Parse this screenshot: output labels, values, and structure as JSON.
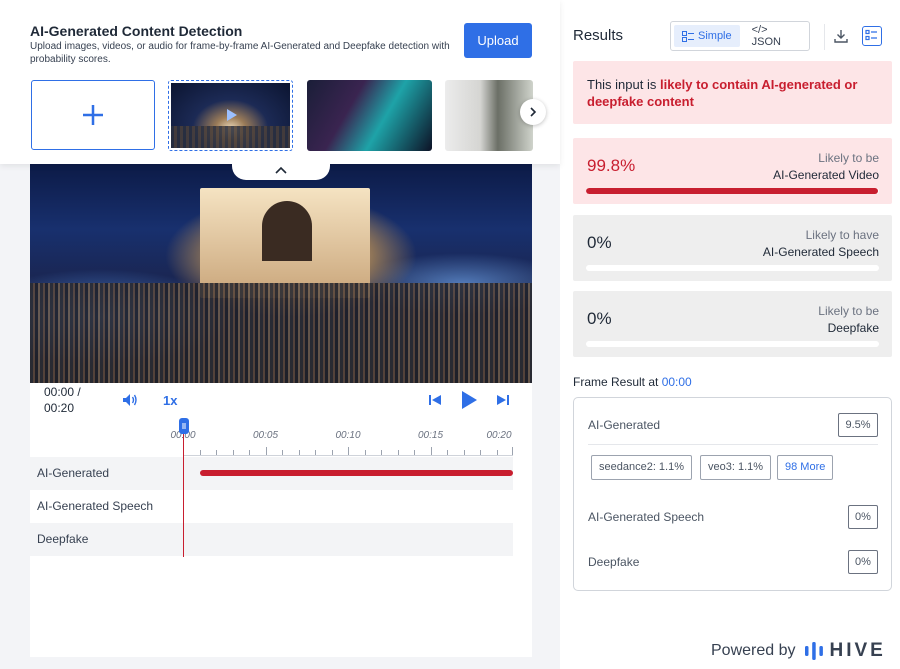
{
  "header": {
    "title": "AI-Generated Content Detection",
    "description": "Upload images, videos, or audio for frame-by-frame AI-Generated and Deepfake detection with probability scores.",
    "upload_label": "Upload"
  },
  "player": {
    "time": "00:00 /\n00:20",
    "speed": "1x"
  },
  "timeline": {
    "ticks": [
      "00:00",
      "00:05",
      "00:10",
      "00:15",
      "00:20"
    ],
    "tracks": [
      "AI-Generated",
      "AI-Generated Speech",
      "Deepfake"
    ]
  },
  "results": {
    "title": "Results",
    "toggle_simple": "Simple",
    "toggle_json": "</> JSON",
    "verdict_prefix": "This input is ",
    "verdict_highlight": "likely to contain AI-generated or deepfake content",
    "cards": [
      {
        "value": "99.8%",
        "line1": "Likely to be",
        "line2": "AI-Generated Video",
        "fill": 0.998
      },
      {
        "value": "0%",
        "line1": "Likely to have",
        "line2": "AI-Generated Speech",
        "fill": 0
      },
      {
        "value": "0%",
        "line1": "Likely to be",
        "line2": "Deepfake",
        "fill": 0
      }
    ]
  },
  "frame": {
    "heading": "Frame Result at ",
    "timestamp": "00:00",
    "ai_label": "AI-Generated",
    "ai_value": "9.5%",
    "chips": [
      "seedance2: 1.1%",
      "veo3: 1.1%"
    ],
    "more_label": "98 More",
    "speech_label": "AI-Generated Speech",
    "speech_value": "0%",
    "deepfake_label": "Deepfake",
    "deepfake_value": "0%"
  },
  "footer": {
    "powered_by": "Powered by",
    "brand": "HIVE"
  },
  "colors": {
    "accent": "#2f6fe6",
    "danger": "#c81e2f",
    "danger_bg": "#fde5e7"
  }
}
